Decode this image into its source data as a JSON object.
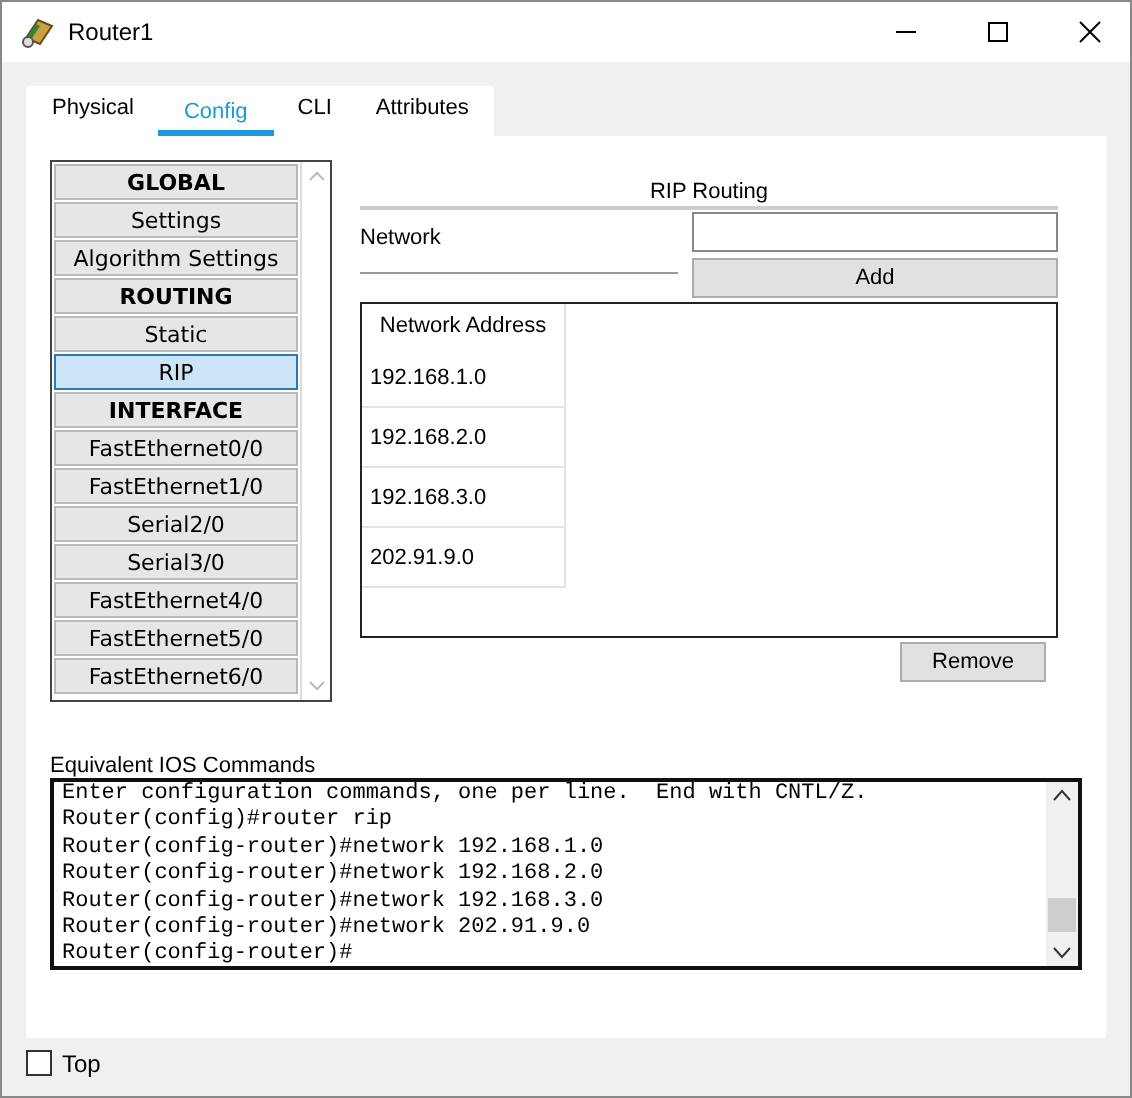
{
  "window": {
    "title": "Router1"
  },
  "tabs": [
    {
      "label": "Physical",
      "selected": false
    },
    {
      "label": "Config",
      "selected": true
    },
    {
      "label": "CLI",
      "selected": false
    },
    {
      "label": "Attributes",
      "selected": false
    }
  ],
  "sidebar": {
    "items": [
      {
        "label": "GLOBAL",
        "kind": "header",
        "selected": false
      },
      {
        "label": "Settings",
        "kind": "item",
        "selected": false
      },
      {
        "label": "Algorithm Settings",
        "kind": "item",
        "selected": false
      },
      {
        "label": "ROUTING",
        "kind": "header",
        "selected": false
      },
      {
        "label": "Static",
        "kind": "item",
        "selected": false
      },
      {
        "label": "RIP",
        "kind": "item",
        "selected": true
      },
      {
        "label": "INTERFACE",
        "kind": "header",
        "selected": false
      },
      {
        "label": "FastEthernet0/0",
        "kind": "item",
        "selected": false
      },
      {
        "label": "FastEthernet1/0",
        "kind": "item",
        "selected": false
      },
      {
        "label": "Serial2/0",
        "kind": "item",
        "selected": false
      },
      {
        "label": "Serial3/0",
        "kind": "item",
        "selected": false
      },
      {
        "label": "FastEthernet4/0",
        "kind": "item",
        "selected": false
      },
      {
        "label": "FastEthernet5/0",
        "kind": "item",
        "selected": false
      },
      {
        "label": "FastEthernet6/0",
        "kind": "item",
        "selected": false
      }
    ]
  },
  "panel": {
    "title": "RIP Routing",
    "network_label": "Network",
    "add_button": "Add",
    "remove_button": "Remove",
    "table": {
      "columns": [
        "Network Address"
      ],
      "rows": [
        "192.168.1.0",
        "192.168.2.0",
        "192.168.3.0",
        "202.91.9.0"
      ]
    }
  },
  "console": {
    "label": "Equivalent IOS Commands",
    "lines": [
      "Enter configuration commands, one per line.  End with CNTL/Z.",
      "Router(config)#router rip",
      "Router(config-router)#network 192.168.1.0",
      "Router(config-router)#network 192.168.2.0",
      "Router(config-router)#network 192.168.3.0",
      "Router(config-router)#network 202.91.9.0",
      "Router(config-router)#"
    ]
  },
  "footer": {
    "top_checkbox": {
      "label": "Top",
      "checked": false
    }
  }
}
